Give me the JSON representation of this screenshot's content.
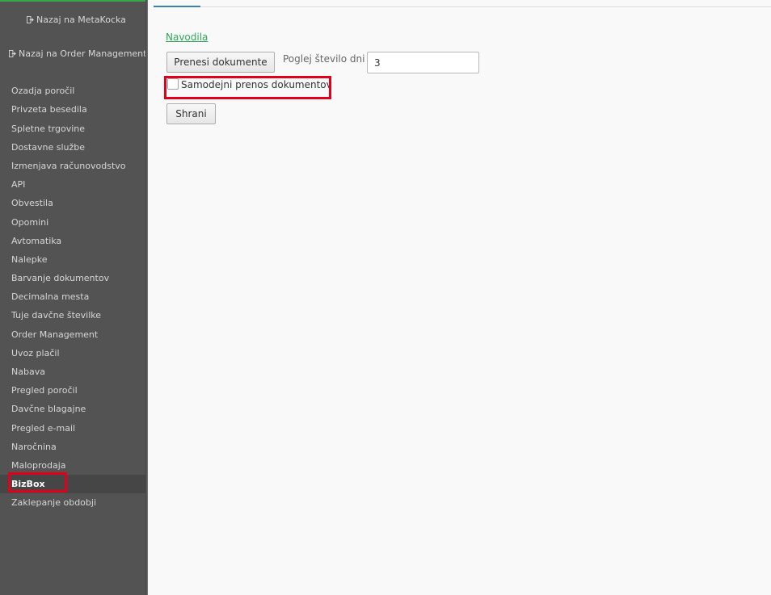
{
  "sidebar": {
    "back_links": [
      {
        "label": "Nazaj na MetaKocka",
        "icon": "logout-icon"
      },
      {
        "label": "Nazaj na Order Management",
        "icon": "logout-icon"
      }
    ],
    "items": [
      {
        "label": "Ozadja poročil"
      },
      {
        "label": "Privzeta besedila"
      },
      {
        "label": "Spletne trgovine"
      },
      {
        "label": "Dostavne službe"
      },
      {
        "label": "Izmenjava računovodstvo"
      },
      {
        "label": "API"
      },
      {
        "label": "Obvestila"
      },
      {
        "label": "Opomini"
      },
      {
        "label": "Avtomatika"
      },
      {
        "label": "Nalepke"
      },
      {
        "label": "Barvanje dokumentov"
      },
      {
        "label": "Decimalna mesta"
      },
      {
        "label": "Tuje davčne številke"
      },
      {
        "label": "Order Management"
      },
      {
        "label": "Uvoz plačil"
      },
      {
        "label": "Nabava"
      },
      {
        "label": "Pregled poročil"
      },
      {
        "label": "Davčne blagajne"
      },
      {
        "label": "Pregled e-mail"
      },
      {
        "label": "Naročnina"
      },
      {
        "label": "Maloprodaja"
      },
      {
        "label": "BizBox",
        "active": true
      },
      {
        "label": "Zaklepanje obdobji"
      }
    ]
  },
  "main": {
    "instructions_link": "Navodila",
    "transfer_button": "Prenesi dokumente",
    "days_label": "Poglej število dni :",
    "days_value": "3",
    "auto_transfer_label": "Samodejni prenos dokumentov",
    "auto_transfer_checked": false,
    "save_button": "Shrani"
  },
  "colors": {
    "sidebar_bg": "#535353",
    "sidebar_active_bg": "#464646",
    "link_green": "#2eaa55",
    "highlight_red": "#e3001b",
    "accent_green": "#37a84a"
  }
}
